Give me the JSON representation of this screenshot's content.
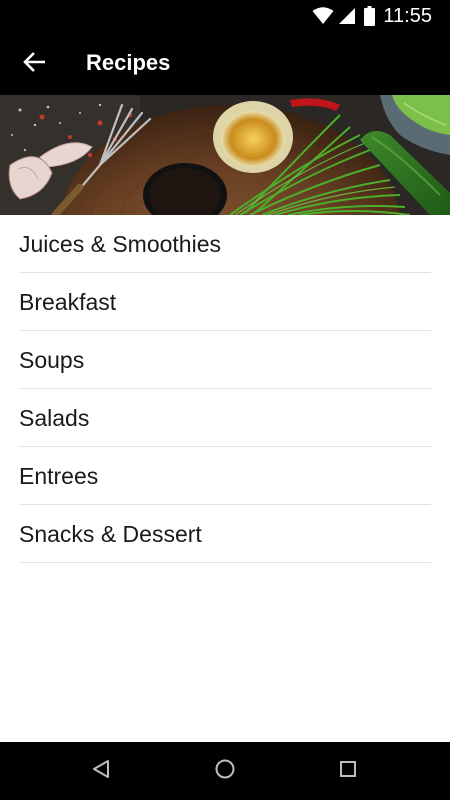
{
  "status_bar": {
    "time": "11:55",
    "icons": [
      "wifi-icon",
      "signal-icon",
      "battery-icon"
    ]
  },
  "app_bar": {
    "title": "Recipes",
    "back_icon": "arrow-back-icon"
  },
  "hero": {
    "description_icon": "food-banner-image"
  },
  "menu": {
    "items": [
      {
        "label": "Juices & Smoothies"
      },
      {
        "label": "Breakfast"
      },
      {
        "label": "Soups"
      },
      {
        "label": "Salads"
      },
      {
        "label": "Entrees"
      },
      {
        "label": "Snacks & Dessert"
      }
    ]
  },
  "nav_bar": {
    "icons": [
      "back-triangle-icon",
      "home-circle-icon",
      "recents-square-icon"
    ]
  },
  "colors": {
    "bar_background": "#000000",
    "content_background": "#ffffff",
    "divider": "#e2e2e2",
    "text": "#1a1a1a"
  }
}
